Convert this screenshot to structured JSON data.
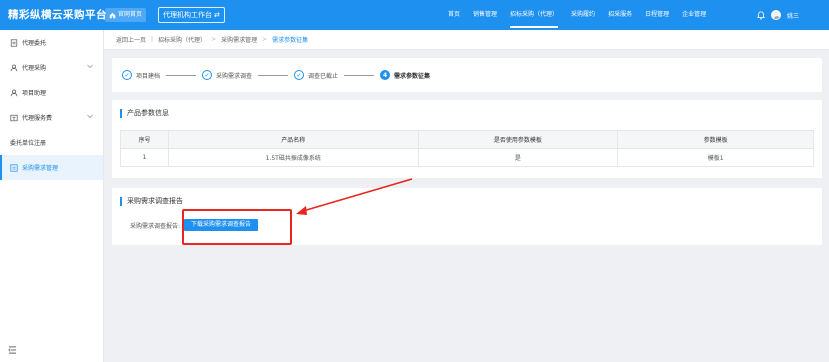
{
  "app": {
    "title": "精彩纵横云采购平台",
    "portal_label": "官网首页",
    "workbench_label": "代理机构工作台",
    "swap_icon": "⇄"
  },
  "topnav": {
    "items": [
      {
        "label": "首页"
      },
      {
        "label": "销售管理"
      },
      {
        "label": "招标采购（代理）"
      },
      {
        "label": "采购履约"
      },
      {
        "label": "招采服务"
      },
      {
        "label": "日程管理"
      },
      {
        "label": "企业管理"
      }
    ],
    "user_name": "姚三"
  },
  "sidebar": {
    "items": [
      {
        "label": "代理委托",
        "icon": "document-icon"
      },
      {
        "label": "代理采购",
        "icon": "user-icon"
      },
      {
        "label": "项目助理",
        "icon": "user-icon"
      },
      {
        "label": "代理服务费",
        "icon": "fee-icon"
      },
      {
        "label": "委托单位注册"
      },
      {
        "label": "采购需求管理",
        "icon": "list-icon"
      }
    ]
  },
  "breadcrumb": {
    "back": "返回上一页",
    "items": [
      "招标采购（代理）",
      "采购需求管理",
      "需求参数征集"
    ]
  },
  "steps": [
    {
      "label": "项目建档",
      "state": "done"
    },
    {
      "label": "采购需求调查",
      "state": "done"
    },
    {
      "label": "调查已截止",
      "state": "done"
    },
    {
      "label": "需求参数征集",
      "state": "current",
      "number": "4"
    }
  ],
  "params": {
    "title": "产品参数信息",
    "columns": [
      "序号",
      "产品名称",
      "是否使用参数模板",
      "参数模板"
    ],
    "rows": [
      [
        "1",
        "1.5T磁共振成像系统",
        "是",
        "模板1"
      ]
    ]
  },
  "report": {
    "title": "采购需求调查报告",
    "label": "采购需求调查报告:",
    "button": "下载采购需求调查报告"
  },
  "colors": {
    "primary": "#1e90f0",
    "annotation_red": "#e8251e"
  }
}
